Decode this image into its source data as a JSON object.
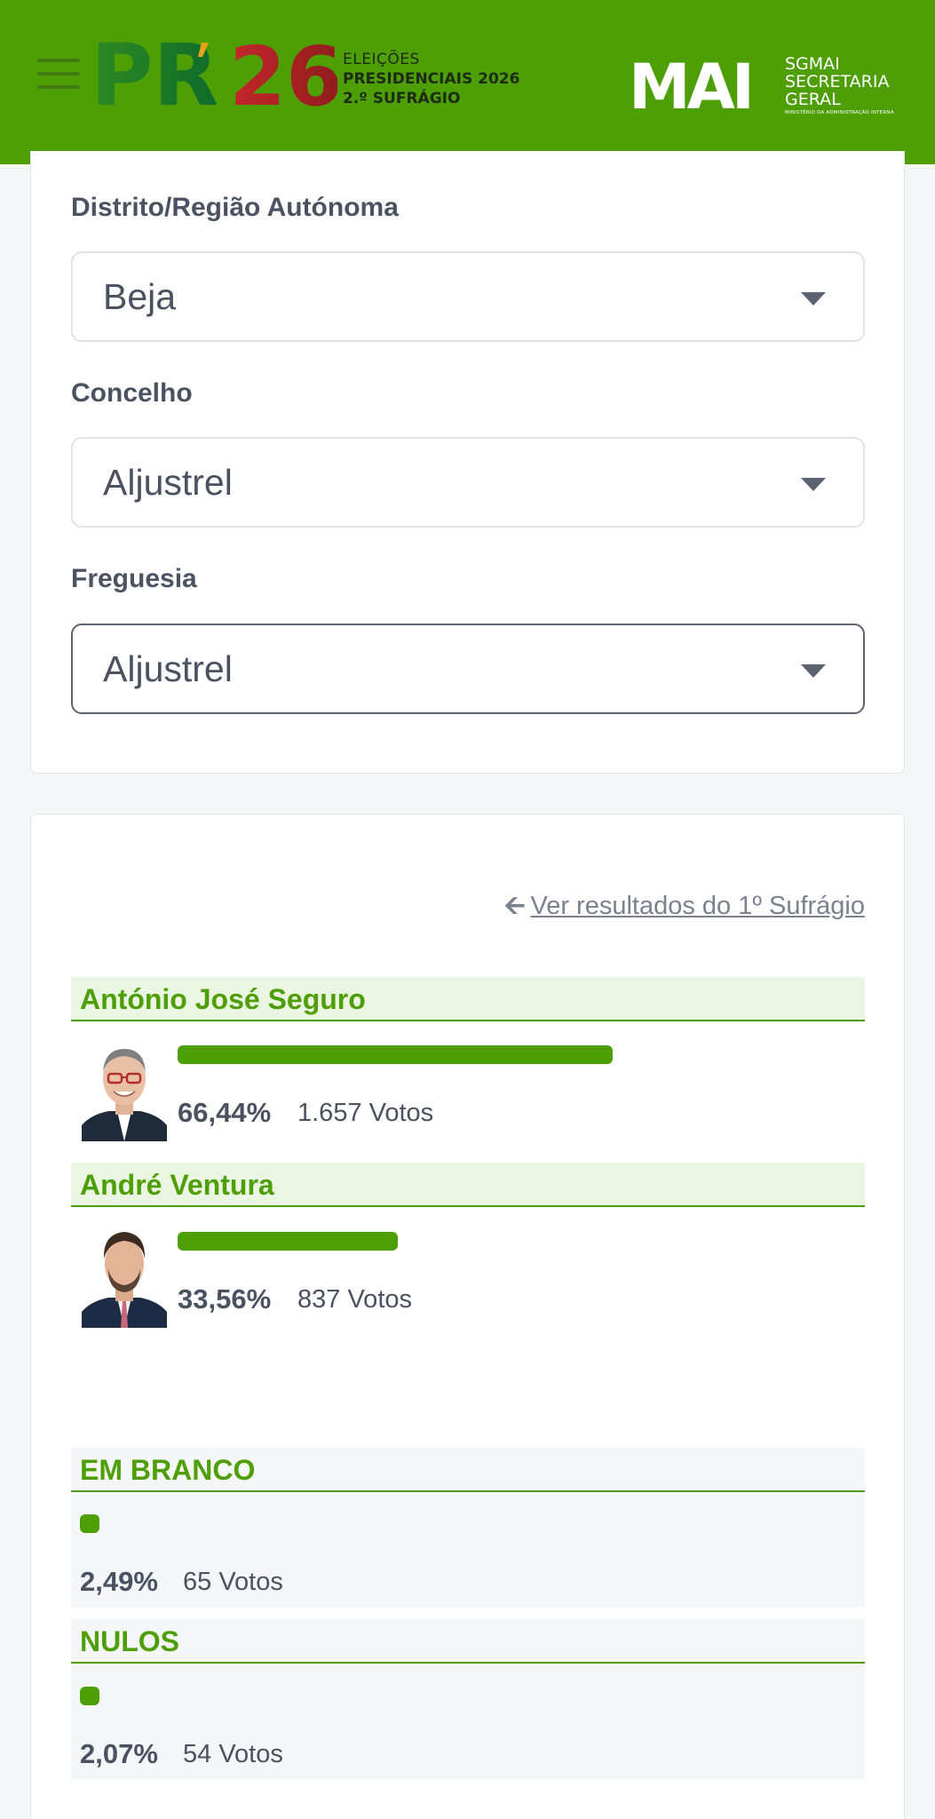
{
  "header": {
    "logo_pr": "PR",
    "logo_year": "26",
    "logo_line1": "ELEIÇÕES",
    "logo_line2": "PRESIDENCIAIS 2026",
    "logo_line3": "2.º SUFRÁGIO",
    "mai_logo": "MAI",
    "org_line1": "SGMAI",
    "org_line2": "SECRETARIA",
    "org_line3": "GERAL",
    "org_line4": "MINISTÉRIO DA ADMINISTRAÇÃO INTERNA",
    "colors": {
      "brand_green": "#4e9f06",
      "logo_red": "#b22222"
    }
  },
  "filters": {
    "district_label": "Distrito/Região Autónoma",
    "district_value": "Beja",
    "municipality_label": "Concelho",
    "municipality_value": "Aljustrel",
    "parish_label": "Freguesia",
    "parish_value": "Aljustrel"
  },
  "results": {
    "prev_round_link": "Ver resultados do 1º Sufrágio",
    "candidates": [
      {
        "name": "António José Seguro",
        "percent": "66,44%",
        "votes": "1.657 Votos",
        "share": 0.6644
      },
      {
        "name": "André Ventura",
        "percent": "33,56%",
        "votes": "837 Votos",
        "share": 0.3356
      }
    ],
    "blank": {
      "label": "EM BRANCO",
      "percent": "2,49%",
      "votes": "65 Votos",
      "share": 0.0249
    },
    "null": {
      "label": "NULOS",
      "percent": "2,07%",
      "votes": "54 Votos",
      "share": 0.0207
    }
  }
}
